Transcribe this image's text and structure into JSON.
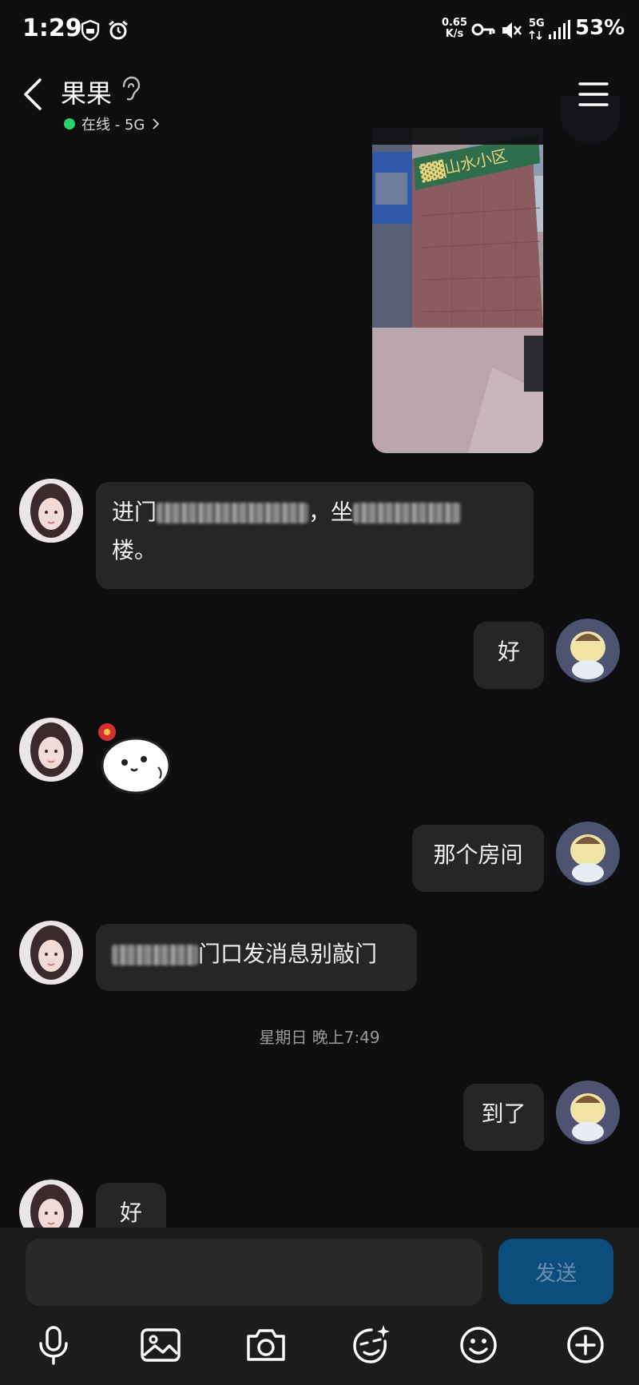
{
  "status_bar": {
    "time": "1:29",
    "net_speed_value": "0.65",
    "net_speed_unit": "K/s",
    "network_type": "5G",
    "battery": "53%"
  },
  "header": {
    "name": "果果",
    "status": "在线 - 5G",
    "online_color": "#28d36b"
  },
  "messages": {
    "m1_part1": "进门",
    "m1_part2": "，坐",
    "m1_part3": "楼。",
    "m2": "好",
    "m3": "那个房间",
    "m4": "门口发消息别敲门",
    "timestamp": "星期日 晚上7:49",
    "m5": "到了",
    "m6": "好"
  },
  "input": {
    "placeholder": "",
    "send_label": "发送"
  },
  "toolbar": {
    "icons": [
      "microphone-icon",
      "image-icon",
      "camera-icon",
      "magic-sticker-icon",
      "emoji-icon",
      "plus-icon"
    ]
  },
  "colors": {
    "background": "#0e0e10",
    "bubble": "#262628",
    "send_button": "#0b4d7c"
  }
}
